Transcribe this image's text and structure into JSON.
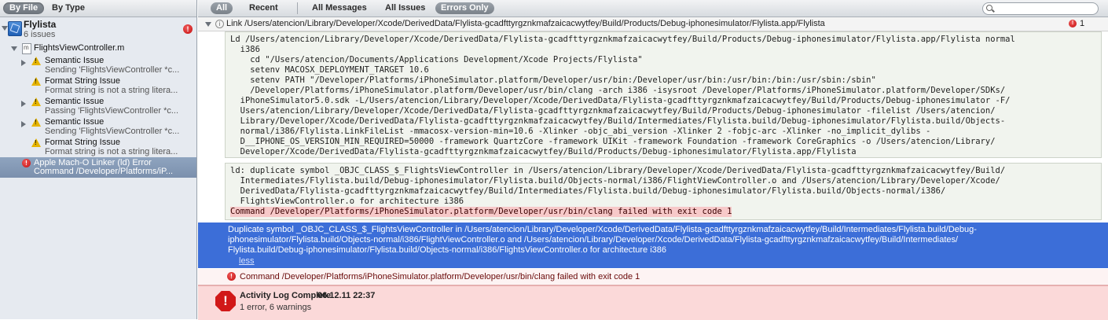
{
  "left_toolbar": {
    "by_file": "By File",
    "by_type": "By Type"
  },
  "project": {
    "name": "Flylista",
    "issues": "6 issues",
    "error_badge": "!"
  },
  "file": {
    "name": "FlightsViewController.m"
  },
  "issues": [
    {
      "title": "Semantic Issue",
      "detail": "Sending 'FlightsViewController *c..."
    },
    {
      "title": "Format String Issue",
      "detail": "Format string is not a string litera..."
    },
    {
      "title": "Semantic Issue",
      "detail": "Passing 'FlightsViewController *c..."
    },
    {
      "title": "Semantic Issue",
      "detail": "Sending 'FlightsViewController *c..."
    },
    {
      "title": "Format String Issue",
      "detail": "Format string is not a string litera..."
    }
  ],
  "selected_issue": {
    "title": "Apple Mach-O Linker (ld) Error",
    "detail": "Command /Developer/Platforms/iP..."
  },
  "right_toolbar": {
    "all": "All",
    "recent": "Recent",
    "all_messages": "All Messages",
    "all_issues": "All Issues",
    "errors_only": "Errors Only",
    "search_placeholder": ""
  },
  "link_row": {
    "text": "Link /Users/atencion/Library/Developer/Xcode/DerivedData/Flylista-gcadfttyrgznkmafzaicacwytfey/Build/Products/Debug-iphonesimulator/Flylista.app/Flylista",
    "count": "1"
  },
  "ld_command": "Ld /Users/atencion/Library/Developer/Xcode/DerivedData/Flylista-gcadfttyrgznkmafzaicacwytfey/Build/Products/Debug-iphonesimulator/Flylista.app/Flylista normal\n  i386\n    cd \"/Users/atencion/Documents/Applications Development/Xcode Projects/Flylista\"\n    setenv MACOSX_DEPLOYMENT_TARGET 10.6\n    setenv PATH \"/Developer/Platforms/iPhoneSimulator.platform/Developer/usr/bin:/Developer/usr/bin:/usr/bin:/bin:/usr/sbin:/sbin\"\n    /Developer/Platforms/iPhoneSimulator.platform/Developer/usr/bin/clang -arch i386 -isysroot /Developer/Platforms/iPhoneSimulator.platform/Developer/SDKs/\n  iPhoneSimulator5.0.sdk -L/Users/atencion/Library/Developer/Xcode/DerivedData/Flylista-gcadfttyrgznkmafzaicacwytfey/Build/Products/Debug-iphonesimulator -F/\n  Users/atencion/Library/Developer/Xcode/DerivedData/Flylista-gcadfttyrgznkmafzaicacwytfey/Build/Products/Debug-iphonesimulator -filelist /Users/atencion/\n  Library/Developer/Xcode/DerivedData/Flylista-gcadfttyrgznkmafzaicacwytfey/Build/Intermediates/Flylista.build/Debug-iphonesimulator/Flylista.build/Objects-\n  normal/i386/Flylista.LinkFileList -mmacosx-version-min=10.6 -Xlinker -objc_abi_version -Xlinker 2 -fobjc-arc -Xlinker -no_implicit_dylibs -\n  D__IPHONE_OS_VERSION_MIN_REQUIRED=50000 -framework QuartzCore -framework UIKit -framework Foundation -framework CoreGraphics -o /Users/atencion/Library/\n  Developer/Xcode/DerivedData/Flylista-gcadfttyrgznkmafzaicacwytfey/Build/Products/Debug-iphonesimulator/Flylista.app/Flylista",
  "ld_duplicate": "ld: duplicate symbol _OBJC_CLASS_$_FlightsViewController in /Users/atencion/Library/Developer/Xcode/DerivedData/Flylista-gcadfttyrgznkmafzaicacwytfey/Build/\n  Intermediates/Flylista.build/Debug-iphonesimulator/Flylista.build/Objects-normal/i386/FlightViewController.o and /Users/atencion/Library/Developer/Xcode/\n  DerivedData/Flylista-gcadfttyrgznkmafzaicacwytfey/Build/Intermediates/Flylista.build/Debug-iphonesimulator/Flylista.build/Objects-normal/i386/\n  FlightsViewController.o for architecture i386",
  "ld_failed": "Command /Developer/Platforms/iPhoneSimulator.platform/Developer/usr/bin/clang failed with exit code 1",
  "duplicate_message": "Duplicate symbol _OBJC_CLASS_$_FlightsViewController in /Users/atencion/Library/Developer/Xcode/DerivedData/Flylista-gcadfttyrgznkmafzaicacwytfey/Build/Intermediates/Flylista.build/Debug-\niphonesimulator/Flylista.build/Objects-normal/i386/FlightViewController.o and /Users/atencion/Library/Developer/Xcode/DerivedData/Flylista-gcadfttyrgznkmafzaicacwytfey/Build/Intermediates/\nFlylista.build/Debug-iphonesimulator/Flylista.build/Objects-normal/i386/FlightsViewController.o for architecture i386",
  "less_link": "less",
  "command_error": "Command /Developer/Platforms/iPhoneSimulator.platform/Developer/usr/bin/clang failed with exit code 1",
  "activity": {
    "title": "Activity Log Complete",
    "time": "06.12.11 22:37",
    "summary": "1 error, 6 warnings"
  },
  "colors": {
    "selection_blue": "#3c6ed8",
    "error_red": "#d11818",
    "warning_yellow": "#e6b400",
    "sidebar_bg": "#e6eaf0"
  }
}
